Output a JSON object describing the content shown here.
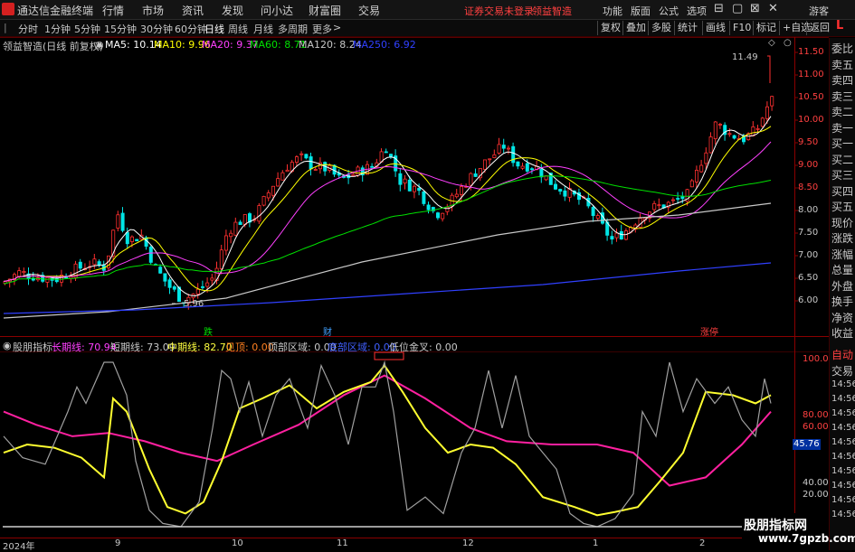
{
  "menubar": {
    "app_title": "通达信金融终端",
    "items": [
      "行情",
      "市场",
      "资讯",
      "发现",
      "问小达",
      "财富圈",
      "交易"
    ],
    "login_status": "证券交易未登录",
    "stock_name_link": "领益智造",
    "right_items": [
      "功能",
      "版面",
      "公式",
      "选项"
    ],
    "user": "游客"
  },
  "toolbar": {
    "periods": [
      "分时",
      "1分钟",
      "5分钟",
      "15分钟",
      "30分钟",
      "60分钟",
      "日线",
      "周线",
      "月线",
      "多周期",
      "更多"
    ],
    "active_period": "日线",
    "buttons": [
      "复权",
      "叠加",
      "多股",
      "统计",
      "画线",
      "F10",
      "标记",
      "+自选",
      "返回"
    ],
    "marker": "L"
  },
  "main_chart": {
    "header_title": "领益智造(日线 前复权)",
    "ma": [
      {
        "label": "MA5: 10.14",
        "color": "#ffffff"
      },
      {
        "label": "MA10: 9.96",
        "color": "#ffff00"
      },
      {
        "label": "MA20: 9.37",
        "color": "#ff40ff"
      },
      {
        "label": "MA60: 8.71",
        "color": "#00e000"
      },
      {
        "label": "MA120: 8.24",
        "color": "#c8c8c8"
      },
      {
        "label": "MA250: 6.92",
        "color": "#3040ff"
      }
    ],
    "high_annotation": "11.49",
    "low_annotation": "5.96",
    "price_axis": [
      "11.50",
      "11.00",
      "10.50",
      "10.00",
      "9.50",
      "9.00",
      "8.50",
      "8.00",
      "7.50",
      "7.00",
      "6.50",
      "6.00"
    ],
    "events": [
      {
        "label": "跌",
        "color": "#00e000"
      },
      {
        "label": "财",
        "color": "#40a0ff"
      },
      {
        "label": "涨停",
        "color": "#ff4040"
      }
    ]
  },
  "indicator": {
    "name": "股朋指标",
    "long_label": "长期线: 70.94",
    "short_label": "短期线: 73.09",
    "mid_label": "中期线: 82.70",
    "top_label": "见顶: 0.00",
    "top_zone_label": "顶部区域: 0.00",
    "bottom_zone_label": "底部区域: 0.00",
    "low_gold_label": "低位金叉: 0.00",
    "axis": [
      "100.00",
      "80.00",
      "60.00",
      "40.00",
      "20.00"
    ],
    "current_value": "45.76"
  },
  "right_panel": {
    "items": [
      "委比",
      "卖五",
      "卖四",
      "卖三",
      "卖二",
      "卖一",
      "买一",
      "买二",
      "买三",
      "买四",
      "买五",
      "现价",
      "涨跌",
      "涨幅",
      "总量",
      "外盘",
      "换手",
      "净资",
      "收益"
    ],
    "lower": [
      "自动",
      "交易"
    ],
    "times": [
      "14:56",
      "14:56",
      "14:56",
      "14:56",
      "14:56",
      "14:56",
      "14:56",
      "14:56",
      "14:56",
      "14:56"
    ]
  },
  "dates": [
    "2024年",
    "9",
    "10",
    "11",
    "12",
    "1",
    "2"
  ],
  "watermark": {
    "title": "股朋指标网",
    "url": "www.7gpzb.com"
  },
  "colors": {
    "up": "#ff3030",
    "down": "#00e5e5",
    "bg": "#000000",
    "accent": "#ff0000"
  }
}
